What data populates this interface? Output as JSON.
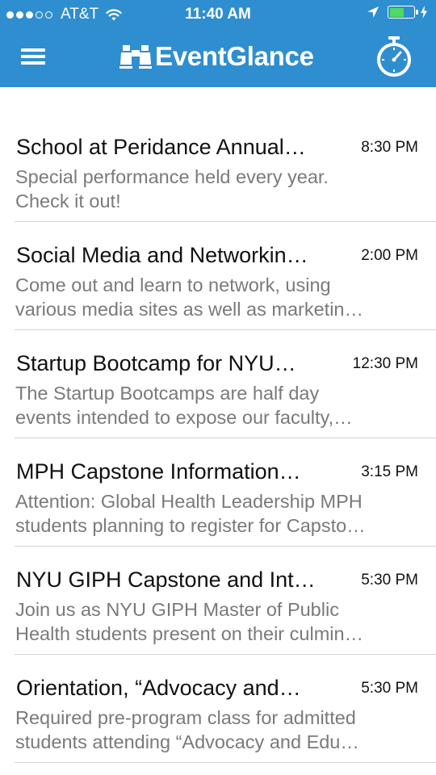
{
  "status_bar": {
    "carrier": "AT&T",
    "time": "11:40 AM",
    "signal_bars_filled": 3,
    "signal_bars_total": 5,
    "battery_level": 0.55
  },
  "nav": {
    "app_name": "EventGlance",
    "menu_icon": "hamburger-menu-icon",
    "logo_icon": "binoculars-icon",
    "timer_icon": "stopwatch-icon"
  },
  "colors": {
    "header_bg": "#2f8ed0",
    "battery_fill": "#4cd964",
    "title_text": "#111111",
    "desc_text": "#7a7a7a"
  },
  "events": [
    {
      "title": "School at Peridance Annual…",
      "time": "8:30 PM",
      "desc_line1": "Special performance held every year.",
      "desc_line2": "Check it out!"
    },
    {
      "title": "Social Media and Networkin…",
      "time": "2:00 PM",
      "desc_line1": "Come out and learn to network, using",
      "desc_line2": "various media sites as well as marketin…"
    },
    {
      "title": "Startup Bootcamp for NYU…",
      "time": "12:30 PM",
      "desc_line1": "The Startup Bootcamps are half day",
      "desc_line2": "events intended to expose our faculty,…"
    },
    {
      "title": "MPH Capstone Information…",
      "time": "3:15 PM",
      "desc_line1": "Attention: Global Health Leadership MPH",
      "desc_line2": "students planning to register for Capsto…"
    },
    {
      "title": "NYU GIPH Capstone and Int…",
      "time": "5:30 PM",
      "desc_line1": "Join us as NYU GIPH Master of Public",
      "desc_line2": "Health students present on their culmin…"
    },
    {
      "title": "Orientation, “Advocacy and…",
      "time": "5:30 PM",
      "desc_line1": "Required pre-program class for admitted",
      "desc_line2": "students attending “Advocacy and Edu…"
    }
  ]
}
